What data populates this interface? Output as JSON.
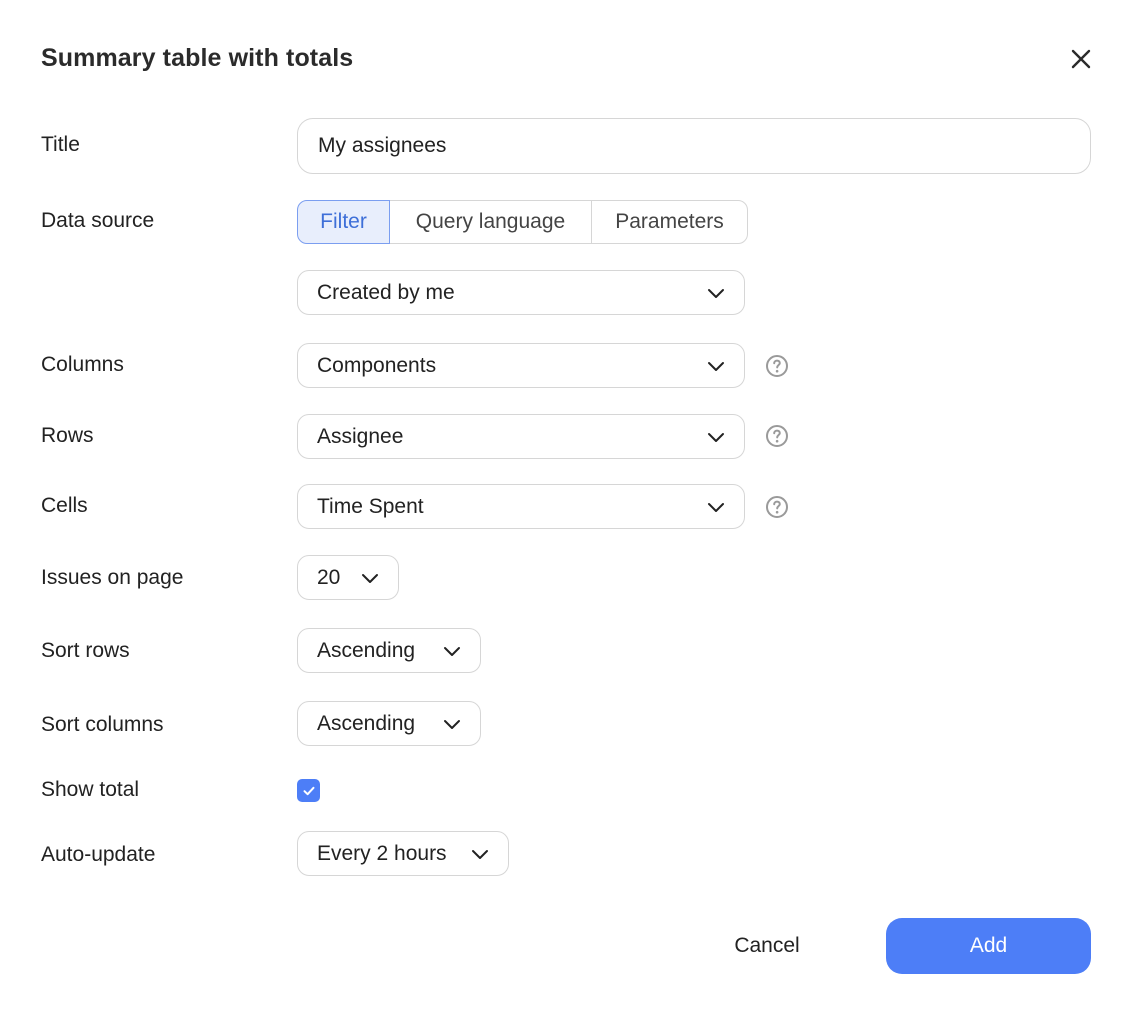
{
  "dialog": {
    "title": "Summary table with totals",
    "close_icon": "close-icon"
  },
  "form": {
    "title_label": "Title",
    "title_value": "My assignees",
    "data_source_label": "Data source",
    "data_source_tabs": [
      "Filter",
      "Query language",
      "Parameters"
    ],
    "data_source_selected": "Filter",
    "filter_value": "Created by me",
    "columns_label": "Columns",
    "columns_value": "Components",
    "rows_label": "Rows",
    "rows_value": "Assignee",
    "cells_label": "Cells",
    "cells_value": "Time Spent",
    "issues_label": "Issues on page",
    "issues_value": "20",
    "sort_rows_label": "Sort rows",
    "sort_rows_value": "Ascending",
    "sort_columns_label": "Sort columns",
    "sort_columns_value": "Ascending",
    "show_total_label": "Show total",
    "show_total_checked": true,
    "auto_update_label": "Auto-update",
    "auto_update_value": "Every 2 hours"
  },
  "footer": {
    "cancel_label": "Cancel",
    "add_label": "Add"
  },
  "colors": {
    "accent": "#4d7ef7",
    "segment_active_bg": "#e8eefc",
    "segment_active_text": "#3e6fd8",
    "border": "#d6d6d6"
  },
  "icons": {
    "dropdown": "chevron-down-icon",
    "help": "question-circle-icon",
    "check": "check-icon"
  }
}
